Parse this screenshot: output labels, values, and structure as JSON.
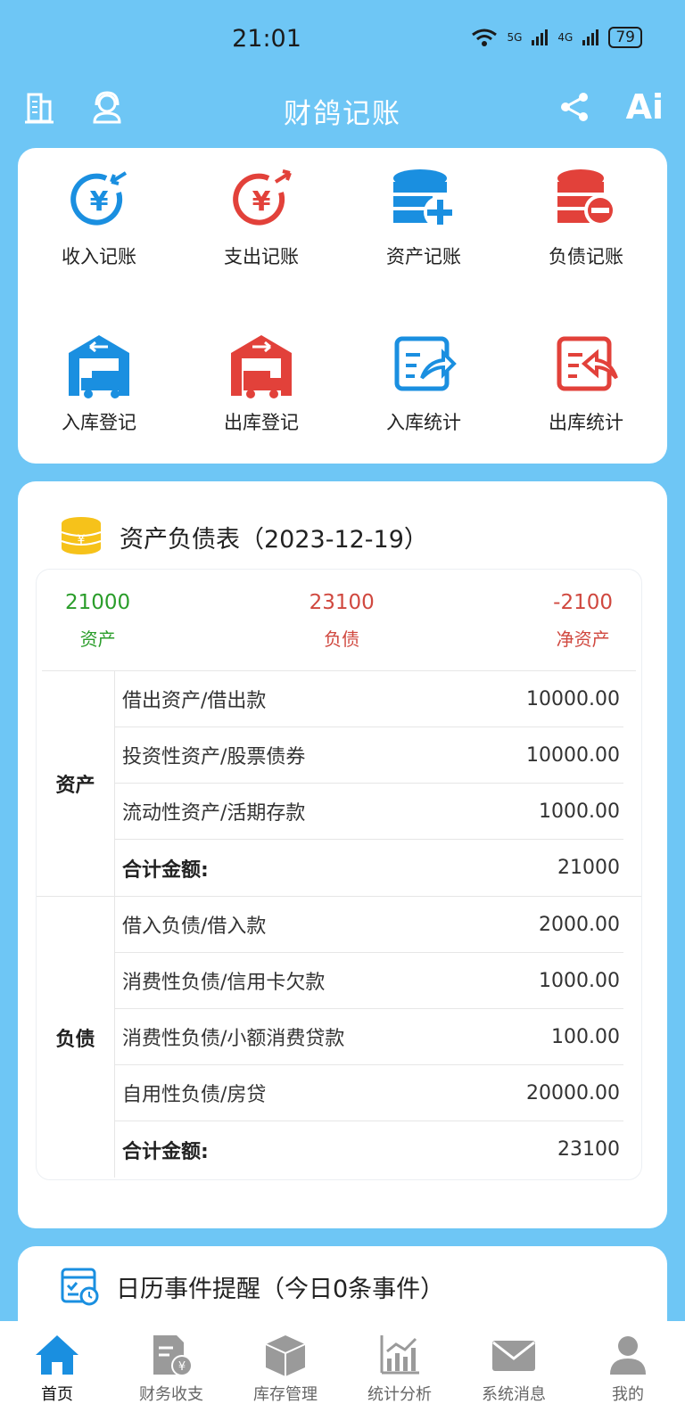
{
  "status_bar": {
    "time": "21:01",
    "signal1": "5G",
    "signal2": "4G",
    "battery": "79"
  },
  "header": {
    "title": "财鸽记账",
    "ai_label": "Ai"
  },
  "quick_actions": [
    {
      "label": "收入记账",
      "icon": "income-yen-icon"
    },
    {
      "label": "支出记账",
      "icon": "expense-yen-icon"
    },
    {
      "label": "资产记账",
      "icon": "asset-add-icon"
    },
    {
      "label": "负债记账",
      "icon": "liability-minus-icon"
    },
    {
      "label": "入库登记",
      "icon": "warehouse-in-icon"
    },
    {
      "label": "出库登记",
      "icon": "warehouse-out-icon"
    },
    {
      "label": "入库统计",
      "icon": "stats-in-icon"
    },
    {
      "label": "出库统计",
      "icon": "stats-out-icon"
    }
  ],
  "balance_sheet": {
    "title": "资产负债表（2023-12-19）",
    "summary": {
      "assets": {
        "value": "21000",
        "label": "资产",
        "color": "#2a9d2a"
      },
      "liabilities": {
        "value": "23100",
        "label": "负债",
        "color": "#d0483f"
      },
      "net": {
        "value": "-2100",
        "label": "净资产",
        "color": "#d0483f"
      }
    },
    "groups": [
      {
        "label": "资产",
        "rows": [
          {
            "name": "借出资产/借出款",
            "amount": "10000.00"
          },
          {
            "name": "投资性资产/股票债券",
            "amount": "10000.00"
          },
          {
            "name": "流动性资产/活期存款",
            "amount": "1000.00"
          }
        ],
        "total_label": "合计金额:",
        "total": "21000"
      },
      {
        "label": "负债",
        "rows": [
          {
            "name": "借入负债/借入款",
            "amount": "2000.00"
          },
          {
            "name": "消费性负债/信用卡欠款",
            "amount": "1000.00"
          },
          {
            "name": "消费性负债/小额消费贷款",
            "amount": "100.00"
          },
          {
            "name": "自用性负债/房贷",
            "amount": "20000.00"
          }
        ],
        "total_label": "合计金额:",
        "total": "23100"
      }
    ]
  },
  "calendar": {
    "title": "日历事件提醒（今日0条事件）"
  },
  "tabs": [
    {
      "label": "首页",
      "icon": "home-icon",
      "active": true
    },
    {
      "label": "财务收支",
      "icon": "finance-doc-icon"
    },
    {
      "label": "库存管理",
      "icon": "box-icon"
    },
    {
      "label": "统计分析",
      "icon": "chart-icon"
    },
    {
      "label": "系统消息",
      "icon": "mail-icon"
    },
    {
      "label": "我的",
      "icon": "user-icon"
    }
  ],
  "colors": {
    "primary": "#6ec6f5",
    "blue": "#1a8fe0",
    "red": "#e2413a",
    "green": "#2a9d2a"
  }
}
